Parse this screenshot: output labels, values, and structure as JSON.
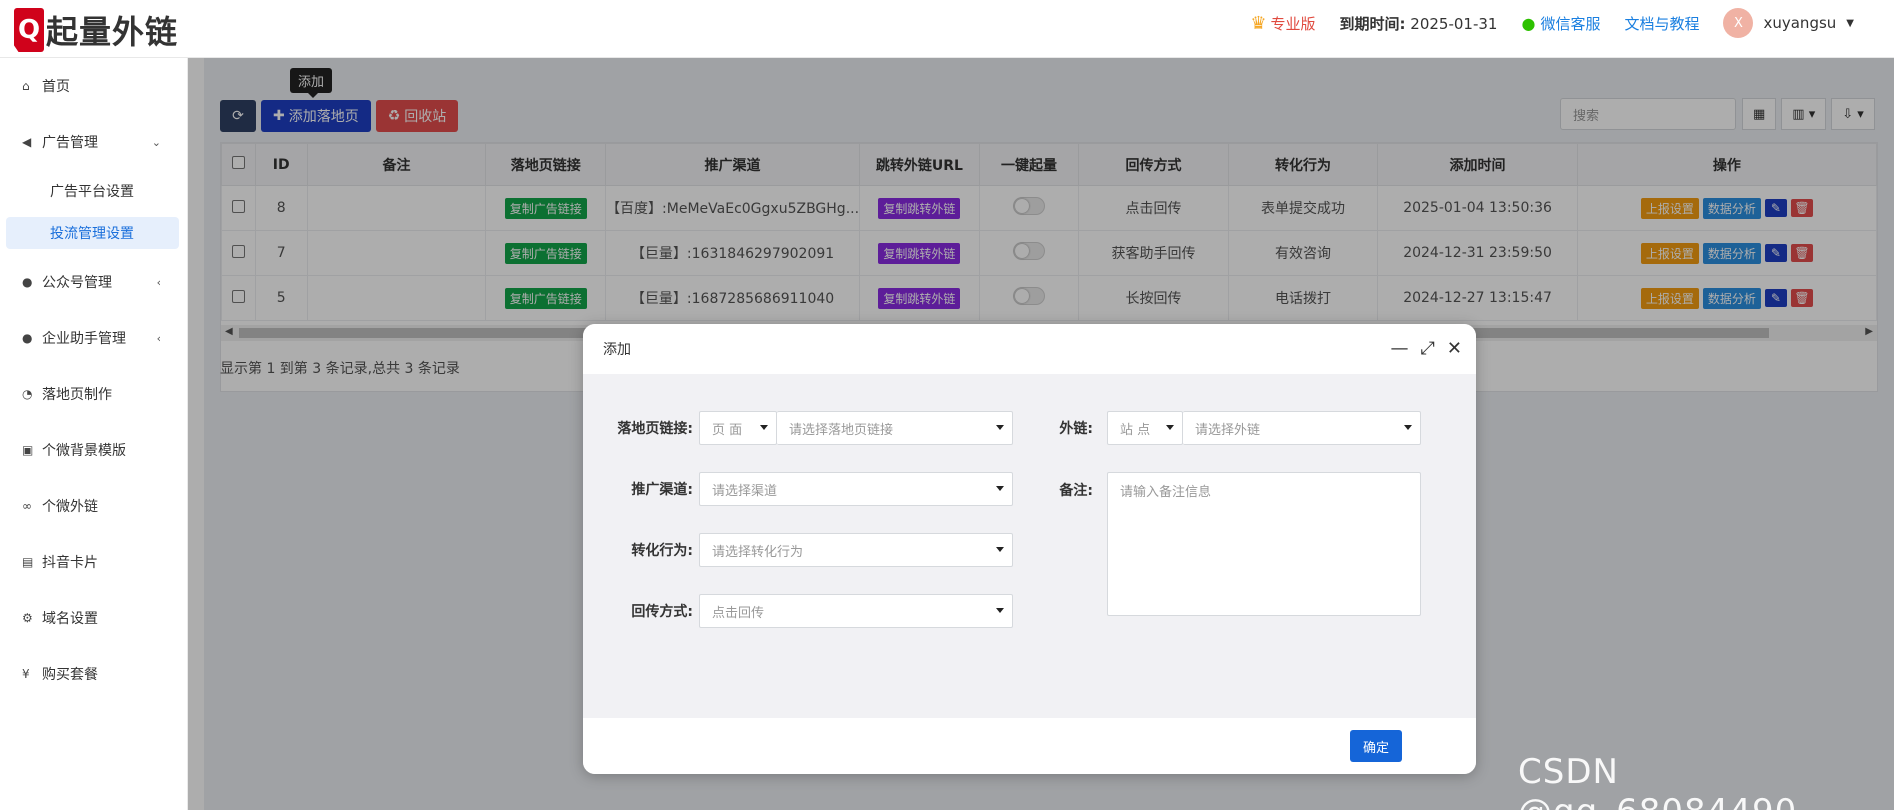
{
  "header": {
    "logo_mark": "Q",
    "logo_text": "起量外链",
    "pro_label": "专业版",
    "expire_label": "到期时间:",
    "expire_date": "2025-01-31",
    "wechat_label": "微信客服",
    "docs_label": "文档与教程",
    "avatar_letter": "X",
    "username": "xuyangsu"
  },
  "sidebar": {
    "items": [
      {
        "icon": "home-icon",
        "glyph": "⌂",
        "label": "首页"
      },
      {
        "icon": "megaphone-icon",
        "glyph": "📢",
        "label": "广告管理",
        "arrow": "⌄"
      },
      {
        "icon": "",
        "glyph": "",
        "label": "广告平台设置",
        "sub": true
      },
      {
        "icon": "",
        "glyph": "",
        "label": "投流管理设置",
        "sub": true,
        "active": true
      },
      {
        "icon": "comment-icon",
        "glyph": "●",
        "label": "公众号管理",
        "arrow": "‹"
      },
      {
        "icon": "wechat-icon",
        "glyph": "●",
        "label": "企业助手管理",
        "arrow": "‹"
      },
      {
        "icon": "dashboard-icon",
        "glyph": "◔",
        "label": "落地页制作"
      },
      {
        "icon": "image-icon",
        "glyph": "▣",
        "label": "个微背景模版"
      },
      {
        "icon": "link-icon",
        "glyph": "∞",
        "label": "个微外链"
      },
      {
        "icon": "id-card-icon",
        "glyph": "▤",
        "label": "抖音卡片"
      },
      {
        "icon": "cogs-icon",
        "glyph": "⚙",
        "label": "域名设置"
      },
      {
        "icon": "yen-icon",
        "glyph": "¥",
        "label": "购买套餐"
      }
    ]
  },
  "toolbar": {
    "add_label": "添加落地页",
    "recycle_label": "回收站",
    "tooltip": "添加",
    "search_placeholder": "搜索"
  },
  "table": {
    "columns": [
      "ID",
      "备注",
      "落地页链接",
      "推广渠道",
      "跳转外链URL",
      "一键起量",
      "回传方式",
      "转化行为",
      "添加时间",
      "操作"
    ],
    "rows": [
      {
        "id": "8",
        "note": "",
        "link_tag": "复制广告链接",
        "channel": "【百度】:MeMeVaEc0Ggxu5ZBGHg...",
        "url_tag": "复制跳转外链",
        "callback": "点击回传",
        "conversion": "表单提交成功",
        "time": "2025-01-04 13:50:36"
      },
      {
        "id": "7",
        "note": "",
        "link_tag": "复制广告链接",
        "channel": "【巨量】:1631846297902091",
        "url_tag": "复制跳转外链",
        "callback": "获客助手回传",
        "conversion": "有效咨询",
        "time": "2024-12-31 23:59:50"
      },
      {
        "id": "5",
        "note": "",
        "link_tag": "复制广告链接",
        "channel": "【巨量】:1687285686911040",
        "url_tag": "复制跳转外链",
        "callback": "长按回传",
        "conversion": "电话拨打",
        "time": "2024-12-27 13:15:47"
      }
    ],
    "ops": {
      "report": "上报设置",
      "analysis": "数据分析"
    },
    "page_info": "显示第 1 到第 3 条记录,总共 3 条记录"
  },
  "modal": {
    "title": "添加",
    "fields": {
      "landing_label": "落地页链接:",
      "landing_type": "页 面",
      "landing_placeholder": "请选择落地页链接",
      "outlink_label": "外链:",
      "outlink_type": "站 点",
      "outlink_placeholder": "请选择外链",
      "channel_label": "推广渠道:",
      "channel_placeholder": "请选择渠道",
      "note_label": "备注:",
      "note_placeholder": "请输入备注信息",
      "conversion_label": "转化行为:",
      "conversion_placeholder": "请选择转化行为",
      "callback_label": "回传方式:",
      "callback_value": "点击回传"
    },
    "ok_label": "确定"
  },
  "watermark": "CSDN @qq_68084490"
}
